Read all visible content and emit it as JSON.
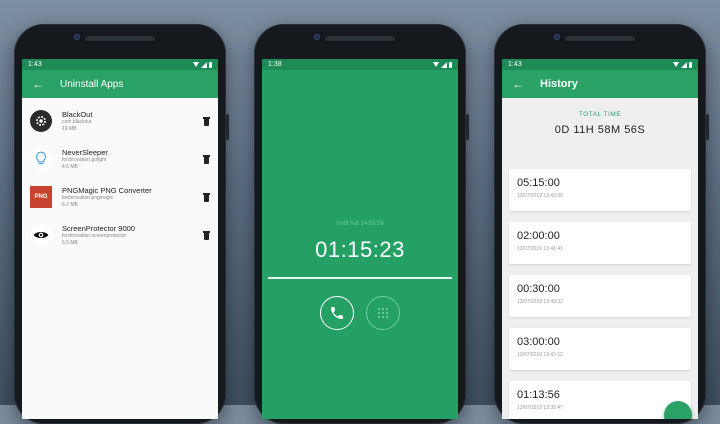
{
  "phone1": {
    "status_time": "1:43",
    "title": "Uninstall Apps",
    "apps": [
      {
        "name": "BlackOut",
        "package": "com.blackout",
        "size": "19 MB"
      },
      {
        "name": "NeverSleeper",
        "package": "fordrrovation.golight",
        "size": "4.6 MB"
      },
      {
        "name": "PNGMagic PNG Converter",
        "package": "fordrrovation.pngmagic",
        "size": "5.2 MB",
        "icon_text": "PNG"
      },
      {
        "name": "ScreenProtector 9000",
        "package": "fordrrovation.screenprotector",
        "size": "5.5 MB"
      }
    ]
  },
  "phone2": {
    "status_time": "1:38",
    "until": "Until Sat 14:53:56",
    "timer": "01:15:23"
  },
  "phone3": {
    "status_time": "1:43",
    "title": "History",
    "total_label": "TOTAL TIME",
    "total_value": "0D 11H 58M 56S",
    "entries": [
      {
        "time": "05:15:00",
        "date": "13/07/2019 13:43:06"
      },
      {
        "time": "02:00:00",
        "date": "13/07/2019 13:41:41"
      },
      {
        "time": "00:30:00",
        "date": "13/07/2019 13:43:32"
      },
      {
        "time": "03:00:00",
        "date": "13/07/2019 13:43:12"
      },
      {
        "time": "01:13:56",
        "date": "13/07/2019 13:35:47"
      }
    ]
  },
  "colors": {
    "primary": "#2aa266",
    "status": "#1e8a55",
    "timer_bg": "#25a065"
  }
}
